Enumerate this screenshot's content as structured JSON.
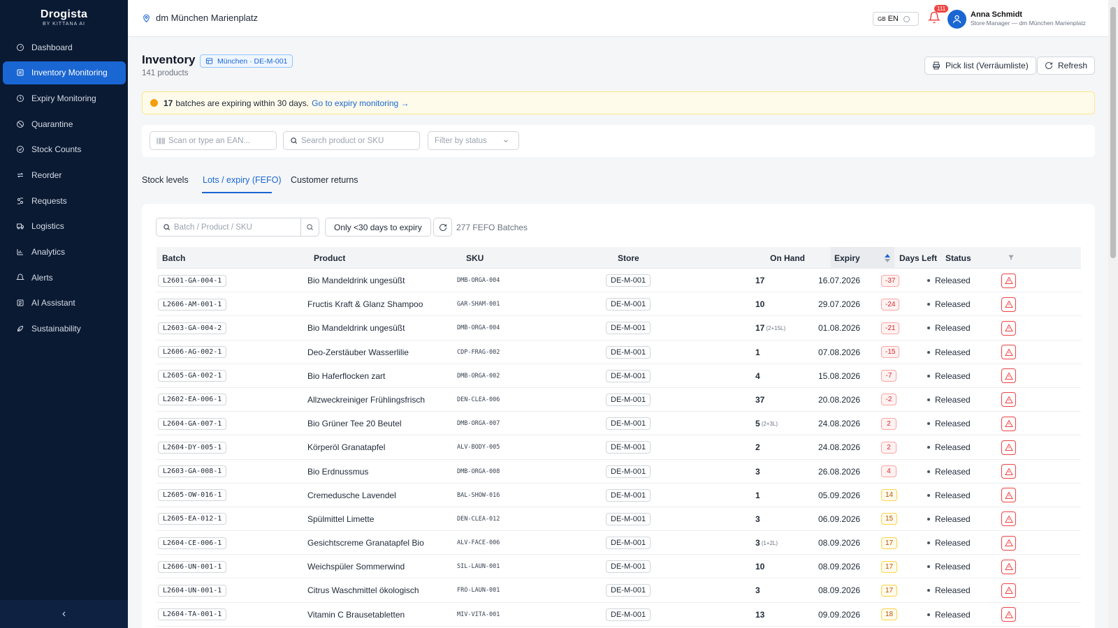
{
  "brand": {
    "name": "Drogista",
    "sub": "BY KITTANA AI"
  },
  "sidebar": {
    "items": [
      {
        "label": "Dashboard",
        "icon": "dashboard-icon",
        "active": false
      },
      {
        "label": "Inventory Monitoring",
        "icon": "inventory-icon",
        "active": true
      },
      {
        "label": "Expiry Monitoring",
        "icon": "clock-icon",
        "active": false
      },
      {
        "label": "Quarantine",
        "icon": "ban-icon",
        "active": false
      },
      {
        "label": "Stock Counts",
        "icon": "check-circle-icon",
        "active": false
      },
      {
        "label": "Reorder",
        "icon": "repeat-icon",
        "active": false
      },
      {
        "label": "Requests",
        "icon": "requests-icon",
        "active": false
      },
      {
        "label": "Logistics",
        "icon": "truck-icon",
        "active": false
      },
      {
        "label": "Analytics",
        "icon": "chart-icon",
        "active": false
      },
      {
        "label": "Alerts",
        "icon": "bell-icon",
        "active": false
      },
      {
        "label": "AI Assistant",
        "icon": "ai-icon",
        "active": false
      },
      {
        "label": "Sustainability",
        "icon": "leaf-icon",
        "active": false
      }
    ],
    "collapse_label": "‹"
  },
  "header": {
    "store": "dm München Marienplatz",
    "lang_flag": "GB",
    "lang": "EN",
    "notifications": "111",
    "user_name": "Anna Schmidt",
    "user_role": "Store Manager — dm München Marienplatz"
  },
  "page": {
    "title": "Inventory",
    "store_chip": "München · DE-M-001",
    "product_count": "141 products",
    "pick_list_label": "Pick list (Verräumliste)",
    "refresh_label": "Refresh"
  },
  "alert": {
    "count": "17",
    "text": "batches are expiring within 30 days.",
    "link": "Go to expiry monitoring →"
  },
  "filters": {
    "ean_placeholder": "Scan or type an EAN...",
    "search_placeholder": "Search product or SKU",
    "status_placeholder": "Filter by status"
  },
  "tabs": [
    {
      "label": "Stock levels",
      "active": false
    },
    {
      "label": "Lots / expiry (FEFO)",
      "active": true
    },
    {
      "label": "Customer returns",
      "active": false
    }
  ],
  "table_toolbar": {
    "search_placeholder": "Batch / Product / SKU",
    "only_label": "Only <30 days to expiry",
    "batch_count": "277 FEFO Batches"
  },
  "columns": [
    "Batch",
    "Product",
    "SKU",
    "Store",
    "On Hand",
    "Expiry",
    "Days Left",
    "Status"
  ],
  "rows": [
    {
      "batch": "L2601-GA-004-1",
      "product": "Bio Mandeldrink ungesüßt",
      "sku": "DMB-ORGA-004",
      "store": "DE-M-001",
      "on_hand": "17",
      "on_hand_sub": "",
      "expiry": "16.07.2026",
      "days": "-37",
      "days_tone": "red",
      "status": "Released"
    },
    {
      "batch": "L2606-AM-001-1",
      "product": "Fructis Kraft & Glanz Shampoo",
      "sku": "GAR-SHAM-001",
      "store": "DE-M-001",
      "on_hand": "10",
      "on_hand_sub": "",
      "expiry": "29.07.2026",
      "days": "-24",
      "days_tone": "red",
      "status": "Released"
    },
    {
      "batch": "L2603-GA-004-2",
      "product": "Bio Mandeldrink ungesüßt",
      "sku": "DMB-ORGA-004",
      "store": "DE-M-001",
      "on_hand": "17",
      "on_hand_sub": "(2+15L)",
      "expiry": "01.08.2026",
      "days": "-21",
      "days_tone": "red",
      "status": "Released"
    },
    {
      "batch": "L2606-AG-002-1",
      "product": "Deo-Zerstäuber Wasserlilie",
      "sku": "CDP-FRAG-002",
      "store": "DE-M-001",
      "on_hand": "1",
      "on_hand_sub": "",
      "expiry": "07.08.2026",
      "days": "-15",
      "days_tone": "red",
      "status": "Released"
    },
    {
      "batch": "L2605-GA-002-1",
      "product": "Bio Haferflocken zart",
      "sku": "DMB-ORGA-002",
      "store": "DE-M-001",
      "on_hand": "4",
      "on_hand_sub": "",
      "expiry": "15.08.2026",
      "days": "-7",
      "days_tone": "red",
      "status": "Released"
    },
    {
      "batch": "L2602-EA-006-1",
      "product": "Allzweckreiniger Frühlingsfrisch",
      "sku": "DEN-CLEA-006",
      "store": "DE-M-001",
      "on_hand": "37",
      "on_hand_sub": "",
      "expiry": "20.08.2026",
      "days": "-2",
      "days_tone": "red",
      "status": "Released"
    },
    {
      "batch": "L2604-GA-007-1",
      "product": "Bio Grüner Tee 20 Beutel",
      "sku": "DMB-ORGA-007",
      "store": "DE-M-001",
      "on_hand": "5",
      "on_hand_sub": "(2+3L)",
      "expiry": "24.08.2026",
      "days": "2",
      "days_tone": "red",
      "status": "Released"
    },
    {
      "batch": "L2604-DY-005-1",
      "product": "Körperöl Granatapfel",
      "sku": "ALV-BODY-005",
      "store": "DE-M-001",
      "on_hand": "2",
      "on_hand_sub": "",
      "expiry": "24.08.2026",
      "days": "2",
      "days_tone": "red",
      "status": "Released"
    },
    {
      "batch": "L2603-GA-008-1",
      "product": "Bio Erdnussmus",
      "sku": "DMB-ORGA-008",
      "store": "DE-M-001",
      "on_hand": "3",
      "on_hand_sub": "",
      "expiry": "26.08.2026",
      "days": "4",
      "days_tone": "red",
      "status": "Released"
    },
    {
      "batch": "L2605-OW-016-1",
      "product": "Cremedusche Lavendel",
      "sku": "BAL-SHOW-016",
      "store": "DE-M-001",
      "on_hand": "1",
      "on_hand_sub": "",
      "expiry": "05.09.2026",
      "days": "14",
      "days_tone": "amber",
      "status": "Released"
    },
    {
      "batch": "L2605-EA-012-1",
      "product": "Spülmittel Limette",
      "sku": "DEN-CLEA-012",
      "store": "DE-M-001",
      "on_hand": "3",
      "on_hand_sub": "",
      "expiry": "06.09.2026",
      "days": "15",
      "days_tone": "amber",
      "status": "Released"
    },
    {
      "batch": "L2604-CE-006-1",
      "product": "Gesichtscreme Granatapfel Bio",
      "sku": "ALV-FACE-006",
      "store": "DE-M-001",
      "on_hand": "3",
      "on_hand_sub": "(1+2L)",
      "expiry": "08.09.2026",
      "days": "17",
      "days_tone": "amber",
      "status": "Released"
    },
    {
      "batch": "L2606-UN-001-1",
      "product": "Weichspüler Sommerwind",
      "sku": "SIL-LAUN-001",
      "store": "DE-M-001",
      "on_hand": "10",
      "on_hand_sub": "",
      "expiry": "08.09.2026",
      "days": "17",
      "days_tone": "amber",
      "status": "Released"
    },
    {
      "batch": "L2604-UN-001-1",
      "product": "Citrus Waschmittel ökologisch",
      "sku": "FRO-LAUN-001",
      "store": "DE-M-001",
      "on_hand": "3",
      "on_hand_sub": "",
      "expiry": "08.09.2026",
      "days": "17",
      "days_tone": "amber",
      "status": "Released"
    },
    {
      "batch": "L2604-TA-001-1",
      "product": "Vitamin C Brausetabletten",
      "sku": "MIV-VITA-001",
      "store": "DE-M-001",
      "on_hand": "13",
      "on_hand_sub": "",
      "expiry": "09.09.2026",
      "days": "18",
      "days_tone": "amber",
      "status": "Released"
    }
  ],
  "colors": {
    "primary": "#1a66d2",
    "sidebar_bg": "#0b1a33",
    "danger": "#ef4444",
    "warning": "#f59e0b"
  }
}
